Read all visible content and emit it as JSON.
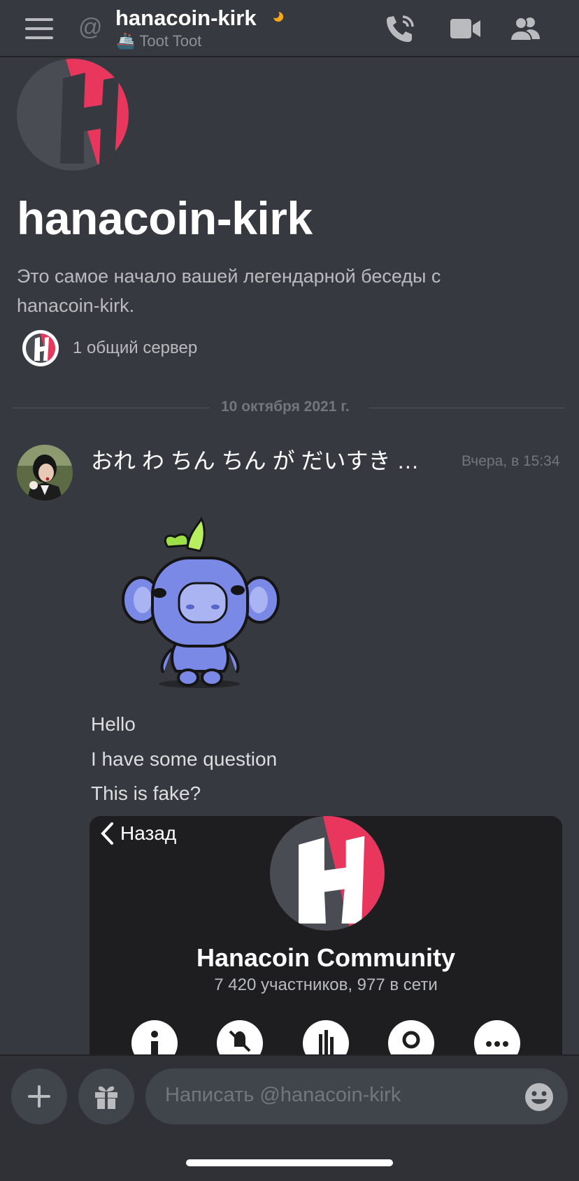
{
  "header": {
    "at_symbol": "@",
    "username": "hanacoin-kirk",
    "status_emoji": "🚢",
    "status_text": "Toot Toot",
    "icons": [
      "menu-icon",
      "phone-call-icon",
      "video-camera-icon",
      "members-icon"
    ]
  },
  "intro": {
    "title": "hanacoin-kirk",
    "description": "Это самое начало вашей легендарной беседы с hanacoin-kirk.",
    "mutual_servers": "1 общий сервер"
  },
  "date_divider": "10 октября 2021 г.",
  "message": {
    "author": "おれ わ ちん ちん が だいすき な…",
    "timestamp": "Вчера, в 15:34",
    "lines": [
      "Hello",
      "I have some question",
      "This is fake?"
    ]
  },
  "embed": {
    "back_label": "Назад",
    "server_name": "Hanacoin Community",
    "member_stats": "7 420 участников, 977 в сети",
    "action_icons": [
      "info-icon",
      "mute-icon",
      "notifications-icon",
      "search-icon",
      "more-icon"
    ]
  },
  "composer": {
    "placeholder": "Написать @hanacoin-kirk"
  },
  "colors": {
    "background": "#36393f",
    "brand_pink": "#e8365d",
    "logo_gray": "#4a4c53",
    "idle_moon": "#faa61a"
  }
}
